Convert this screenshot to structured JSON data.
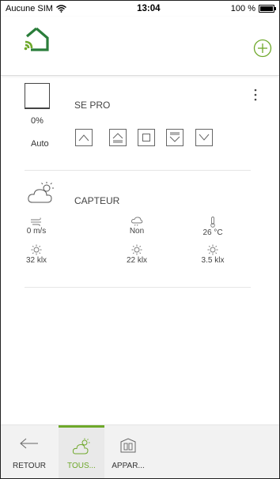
{
  "statusbar": {
    "carrier": "Aucune SIM",
    "time": "13:04",
    "battery": "100 %"
  },
  "colors": {
    "accent": "#6ea82a",
    "text": "#333333"
  },
  "header": {
    "logo_icon": "house-wifi-icon",
    "add_icon": "plus-circle-icon"
  },
  "device": {
    "name": "SE PRO",
    "position": "0%",
    "mode": "Auto",
    "controls": [
      "up",
      "up-full",
      "stop",
      "down-full",
      "down"
    ]
  },
  "sensor": {
    "name": "CAPTEUR",
    "stats": [
      {
        "icon": "wind-icon",
        "value": "0 m/s"
      },
      {
        "icon": "rain-icon",
        "value": "Non"
      },
      {
        "icon": "thermometer-icon",
        "value": "26 °C"
      },
      {
        "icon": "sun-icon",
        "value": "32 klx"
      },
      {
        "icon": "sun-icon",
        "value": "22 klx"
      },
      {
        "icon": "sun-icon",
        "value": "3.5 klx"
      }
    ]
  },
  "bottom_nav": {
    "back": "RETOUR",
    "all": "TOUS...",
    "devices": "APPAR..."
  }
}
